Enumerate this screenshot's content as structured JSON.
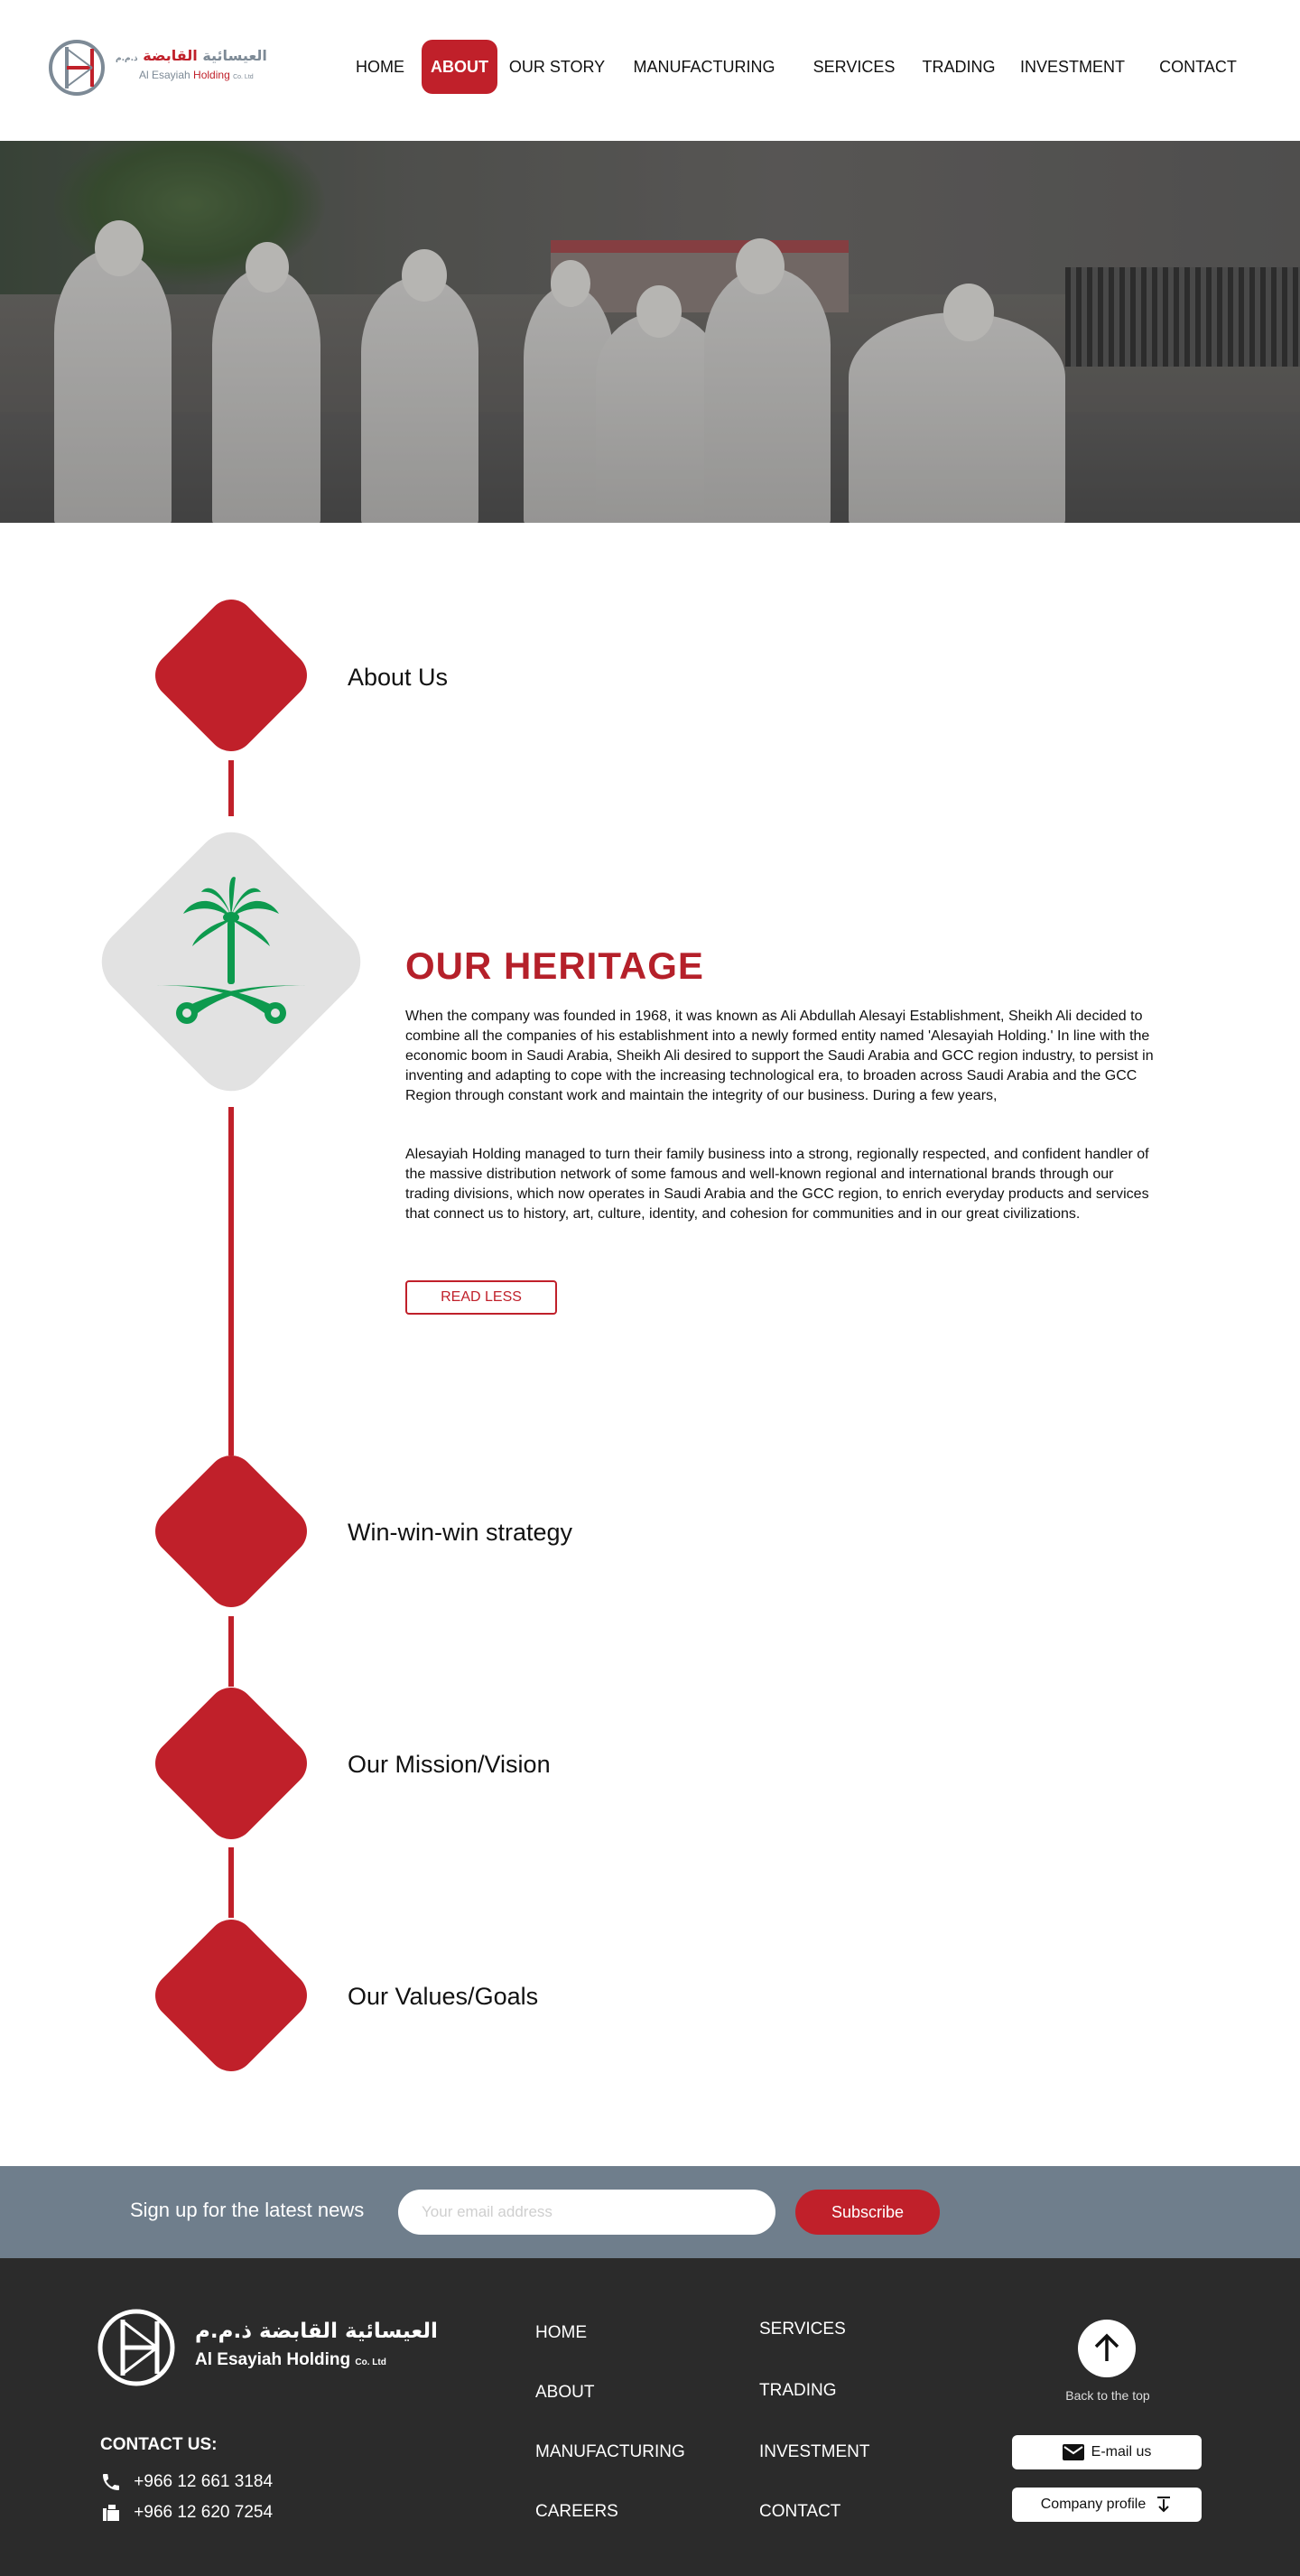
{
  "header": {
    "logo_ar_prefix": "العيسائية",
    "logo_ar_red": "القابضة",
    "logo_ar_suffix": "ذ.م.م",
    "logo_en_prefix": "Al Esayiah",
    "logo_en_red": "Holding",
    "logo_en_suffix": "Co. Ltd",
    "nav": [
      "HOME",
      "ABOUT",
      "OUR STORY",
      "MANUFACTURING",
      "SERVICES",
      "TRADING",
      "INVESTMENT",
      "CONTACT"
    ],
    "active_index": 1
  },
  "timeline": {
    "items": [
      "About Us",
      "Win-win-win strategy",
      "Our Mission/Vision",
      "Our Values/Goals"
    ]
  },
  "heritage": {
    "title": "OUR HERITAGE",
    "paragraph1": "When the company was founded in 1968, it was known as Ali Abdullah Alesayi Establishment, Sheikh Ali decided to combine all the companies of his establishment into a newly formed entity named 'Alesayiah Holding.' In line with the economic boom in Saudi Arabia, Sheikh Ali desired to support the Saudi Arabia and GCC region industry, to persist in inventing and adapting to cope with the increasing technological era, to broaden across Saudi Arabia and the GCC Region through constant work and maintain the integrity of our business. During a few years,",
    "paragraph2": "Alesayiah Holding managed to turn their family business into a strong, regionally respected, and confident handler of the massive distribution network of some famous and well-known regional and international brands through our trading divisions, which now operates in Saudi Arabia and the GCC region, to enrich everyday products and services that connect us to history, art, culture, identity, and cohesion for communities and in our great civilizations.",
    "read_less": "READ LESS"
  },
  "newsletter": {
    "label": "Sign up for the latest news",
    "placeholder": "Your email address",
    "button": "Subscribe"
  },
  "footer": {
    "logo_ar": "العيسائية القابضة ذ.م.م",
    "logo_en": "Al Esayiah Holding",
    "logo_en_suffix": "Co. Ltd",
    "contact_title": "CONTACT US:",
    "phone1": "+966 12 661 3184",
    "fax": "+966 12 620 7254",
    "links_col1": [
      "HOME",
      "ABOUT",
      "MANUFACTURING",
      "CAREERS"
    ],
    "links_col2": [
      "SERVICES",
      "TRADING",
      "INVESTMENT",
      "CONTACT"
    ],
    "back_to_top": "Back to the top",
    "email_button": "E-mail us",
    "profile_button": "Company profile"
  },
  "colors": {
    "accent": "#c0202a",
    "newsletter_bg": "#6f7e8c",
    "footer_bg": "#2b2b2b",
    "emblem_green": "#0d9a4e"
  }
}
